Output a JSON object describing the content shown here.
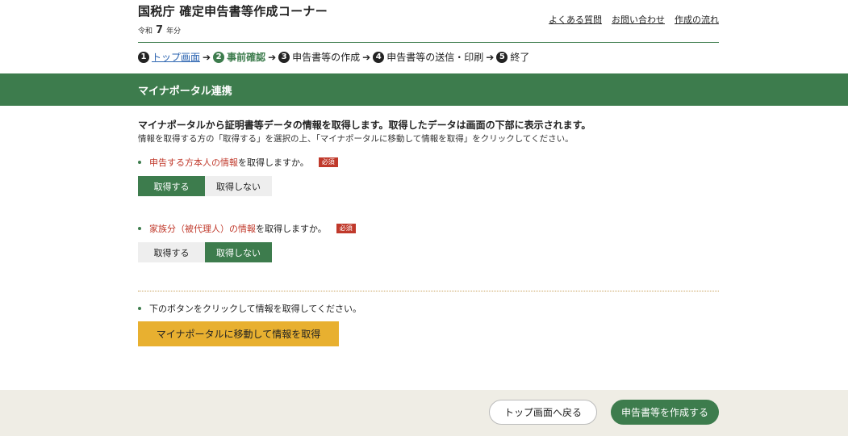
{
  "header": {
    "title": "国税庁 確定申告書等作成コーナー",
    "era_prefix": "令和",
    "era_year": "7",
    "era_suffix": "年分",
    "links": [
      "よくある質問",
      "お問い合わせ",
      "作成の流れ"
    ]
  },
  "steps": [
    {
      "num": "1",
      "label": "トップ画面",
      "state": "link"
    },
    {
      "num": "2",
      "label": "事前確認",
      "state": "current"
    },
    {
      "num": "3",
      "label": "申告書等の作成",
      "state": "upcoming"
    },
    {
      "num": "4",
      "label": "申告書等の送信・印刷",
      "state": "upcoming"
    },
    {
      "num": "5",
      "label": "終了",
      "state": "upcoming"
    }
  ],
  "step_arrow": "➔",
  "banner": {
    "title": "マイナポータル連携"
  },
  "intro": {
    "bold": "マイナポータルから証明書等データの情報を取得します。取得したデータは画面の下部に表示されます。",
    "sub": "情報を取得する方の「取得する」を選択の上、「マイナポータルに移動して情報を取得」をクリックしてください。"
  },
  "questions": [
    {
      "highlight": "申告する方本人の情報",
      "rest": "を取得しますか。",
      "required_label": "必須",
      "options": [
        "取得する",
        "取得しない"
      ],
      "selected": 0
    },
    {
      "highlight": "家族分（被代理人）の情報",
      "rest": "を取得しますか。",
      "required_label": "必須",
      "options": [
        "取得する",
        "取得しない"
      ],
      "selected": 1
    }
  ],
  "note": "下のボタンをクリックして情報を取得してください。",
  "mynaportal_button": "マイナポータルに移動して情報を取得",
  "footer": {
    "back_label": "トップ画面へ戻る",
    "next_label": "申告書等を作成する"
  },
  "colors": {
    "accent_green": "#3d7c4d",
    "required_red": "#c0392b",
    "action_yellow": "#e8b030",
    "footer_bg": "#efede5"
  }
}
